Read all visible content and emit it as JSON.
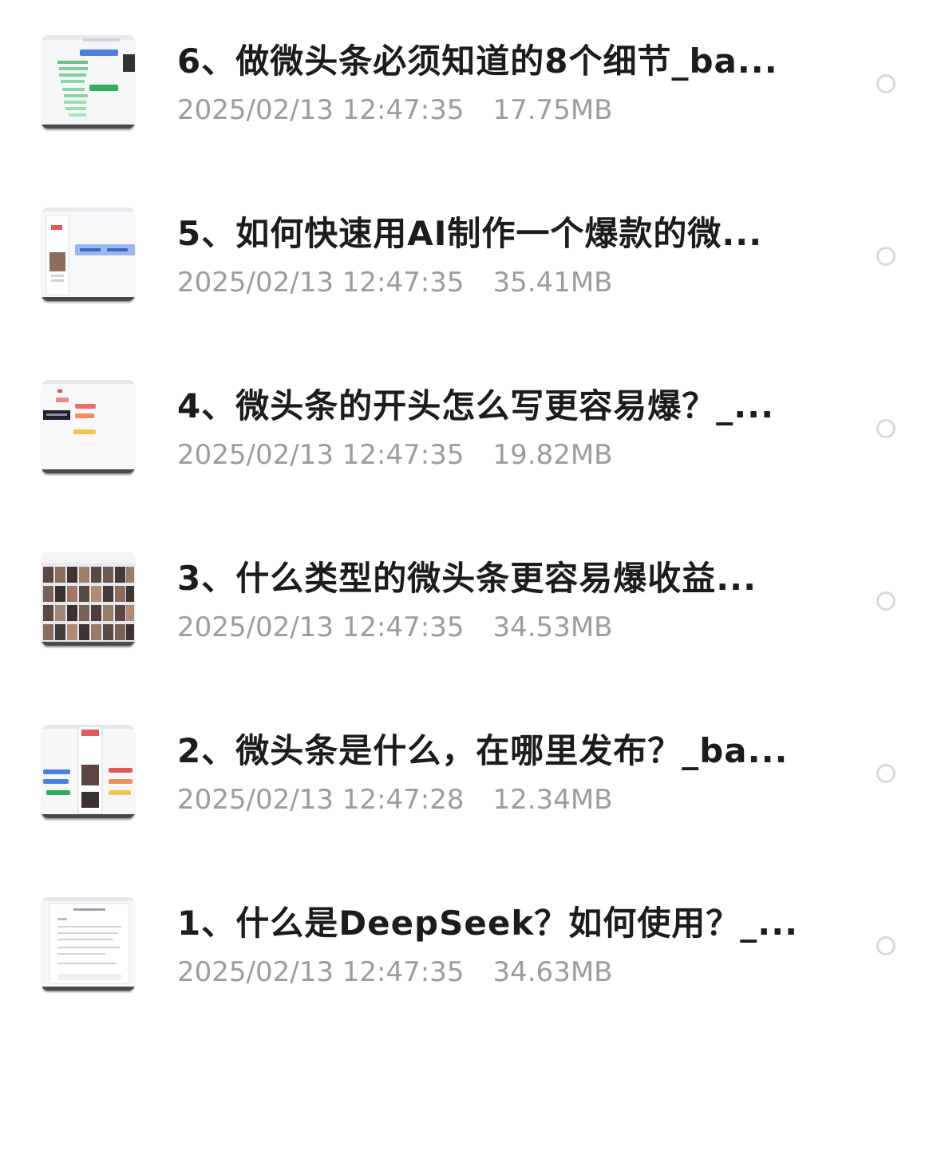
{
  "files": [
    {
      "name": "6、做微头条必须知道的8个细节_ba...",
      "date": "2025/02/13 12:47:35",
      "size": "17.75MB",
      "thumbnail": "mindmap-green-thumbnail",
      "selected": false
    },
    {
      "name": "5、如何快速用AI制作一个爆款的微...",
      "date": "2025/02/13 12:47:35",
      "size": "35.41MB",
      "thumbnail": "screen-portrait-thumbnail",
      "selected": false
    },
    {
      "name": "4、微头条的开头怎么写更容易爆？_...",
      "date": "2025/02/13 12:47:35",
      "size": "19.82MB",
      "thumbnail": "mindmap-red-thumbnail",
      "selected": false
    },
    {
      "name": "3、什么类型的微头条更容易爆收益...",
      "date": "2025/02/13 12:47:35",
      "size": "34.53MB",
      "thumbnail": "photo-grid-thumbnail",
      "selected": false
    },
    {
      "name": "2、微头条是什么，在哪里发布？_ba...",
      "date": "2025/02/13 12:47:28",
      "size": "12.34MB",
      "thumbnail": "phone-mindmap-thumbnail",
      "selected": false
    },
    {
      "name": "1、什么是DeepSeek？如何使用？_...",
      "date": "2025/02/13 12:47:35",
      "size": "34.63MB",
      "thumbnail": "document-thumbnail",
      "selected": false
    }
  ]
}
